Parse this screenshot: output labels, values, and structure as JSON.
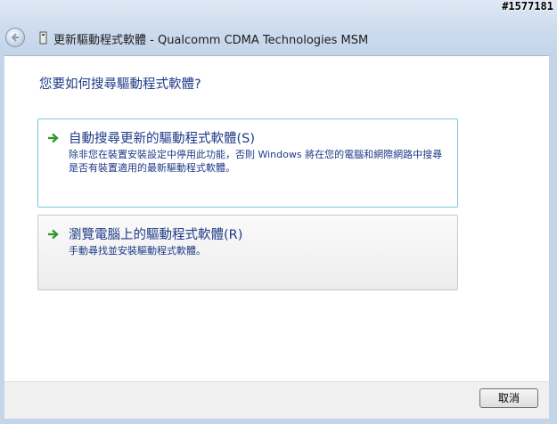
{
  "window": {
    "title": "更新驅動程式軟體 - Qualcomm CDMA Technologies MSM",
    "watermark": "#1577181"
  },
  "icons": {
    "back": "back-arrow-icon",
    "device": "device-icon",
    "option_arrow": "green-arrow-icon"
  },
  "colors": {
    "link_blue": "#1e3a87",
    "arrow_green": "#2e9a2e",
    "selected_border": "#7cc8de"
  },
  "main": {
    "question": "您要如何搜尋驅動程式軟體?",
    "options": [
      {
        "title": "自動搜尋更新的驅動程式軟體(S)",
        "description": "除非您在裝置安裝設定中停用此功能，否則 Windows 將在您的電腦和網際網路中搜尋是否有裝置適用的最新驅動程式軟體。"
      },
      {
        "title": "瀏覽電腦上的驅動程式軟體(R)",
        "description": "手動尋找並安裝驅動程式軟體。"
      }
    ]
  },
  "footer": {
    "cancel_label": "取消"
  }
}
